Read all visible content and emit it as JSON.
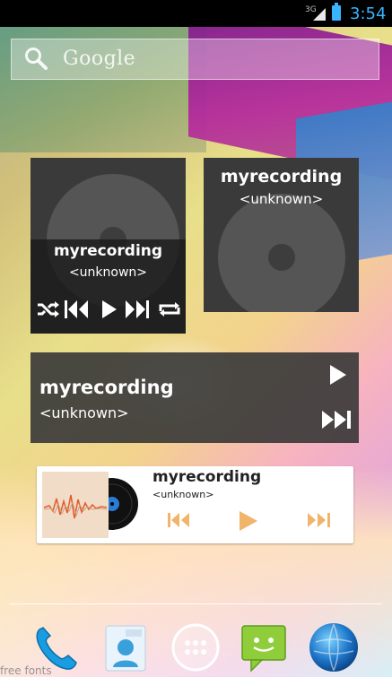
{
  "status_bar": {
    "network": "3G",
    "time": "3:54"
  },
  "search": {
    "label": "Google"
  },
  "widgets": {
    "square_controls": {
      "title": "myrecording",
      "artist": "<unknown>"
    },
    "square_art": {
      "title": "myrecording",
      "artist": "<unknown>"
    },
    "wide_dark": {
      "title": "myrecording",
      "artist": "<unknown>"
    },
    "light_player": {
      "title": "myrecording",
      "artist": "<unknown>"
    }
  },
  "dock": {
    "items": [
      {
        "icon": "phone-icon"
      },
      {
        "icon": "contacts-icon"
      },
      {
        "icon": "all-apps-icon"
      },
      {
        "icon": "messaging-icon"
      },
      {
        "icon": "browser-icon"
      }
    ]
  },
  "footer": {
    "text": "free fonts"
  },
  "colors": {
    "accent_blue": "#36b6ff",
    "controls_orange": "#f0b46a"
  }
}
